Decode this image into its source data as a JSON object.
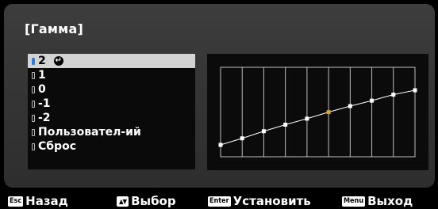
{
  "menu": {
    "title": "[Гамма]",
    "items": [
      {
        "label": "2",
        "selected": true,
        "confirmed": true
      },
      {
        "label": "1",
        "selected": false
      },
      {
        "label": "0",
        "selected": false
      },
      {
        "label": "-1",
        "selected": false
      },
      {
        "label": "-2",
        "selected": false
      },
      {
        "label": "Пользовател-ий",
        "selected": false
      },
      {
        "label": "Сброс",
        "selected": false
      }
    ]
  },
  "curve": {
    "points": [
      0.0,
      0.12,
      0.25,
      0.37,
      0.48,
      0.6,
      0.71,
      0.81,
      0.92,
      1.0
    ],
    "highlight_index": 5,
    "line_color": "#ffffff",
    "highlight_color": "#e0a020",
    "grid_color": "#bfbfbf"
  },
  "footer": {
    "back": {
      "key": "Esc",
      "label": "Назад"
    },
    "select": {
      "key": "▲▼",
      "label": "Выбор"
    },
    "set": {
      "key": "Enter",
      "label": "Установить"
    },
    "exit": {
      "key": "Menu",
      "label": "Выход"
    }
  }
}
